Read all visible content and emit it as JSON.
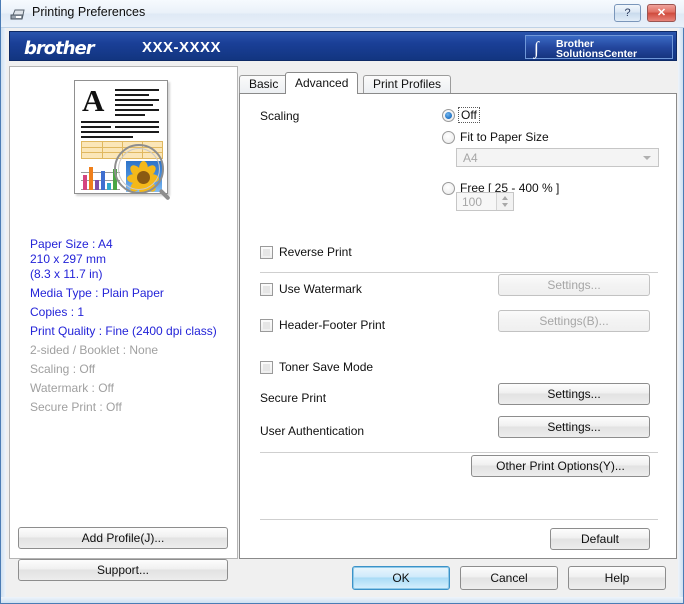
{
  "window": {
    "title": "Printing Preferences",
    "title_icon": "printer-icon",
    "help_button": "?",
    "close_button": "✕"
  },
  "banner": {
    "logo": "brother",
    "model": "XXX-XXXX",
    "solutions_center": {
      "swoosh": "∫",
      "line1": "Brother",
      "line2": "SolutionsCenter"
    }
  },
  "preview": {
    "alt": "document-preview-thumbnail",
    "letter": "A"
  },
  "summary": [
    {
      "text": "Paper Size : A4",
      "state": "active"
    },
    {
      "text": "210 x 297 mm",
      "state": "active"
    },
    {
      "text": "(8.3 x 11.7 in)",
      "state": "active"
    },
    {
      "text": "Media Type : Plain Paper",
      "state": "active"
    },
    {
      "text": "Copies : 1",
      "state": "active"
    },
    {
      "text": "Print Quality : Fine (2400 dpi class)",
      "state": "active"
    },
    {
      "text": "2-sided / Booklet : None",
      "state": "dim"
    },
    {
      "text": "Scaling : Off",
      "state": "dim"
    },
    {
      "text": "Watermark : Off",
      "state": "dim"
    },
    {
      "text": "Secure Print : Off",
      "state": "dim"
    }
  ],
  "left_buttons": {
    "add_profile": "Add Profile(J)...",
    "support": "Support..."
  },
  "tabs": [
    {
      "label": "Basic",
      "active": false
    },
    {
      "label": "Advanced",
      "active": true
    },
    {
      "label": "Print Profiles",
      "active": false
    }
  ],
  "advanced": {
    "scaling": {
      "label": "Scaling",
      "options": [
        {
          "label": "Off",
          "checked": true,
          "focused": true
        },
        {
          "label": "Fit to Paper Size",
          "checked": false,
          "focused": false
        },
        {
          "label": "Free [ 25 - 400 % ]",
          "checked": false,
          "focused": false
        }
      ],
      "paper_size_value": "A4",
      "free_value": "100"
    },
    "reverse_print": {
      "label": "Reverse Print",
      "checked": false
    },
    "use_watermark": {
      "label": "Use Watermark",
      "checked": false,
      "button": "Settings...",
      "button_enabled": false
    },
    "header_footer_print": {
      "label": "Header-Footer Print",
      "checked": false,
      "button": "Settings(B)...",
      "button_enabled": false
    },
    "toner_save_mode": {
      "label": "Toner Save Mode",
      "checked": false
    },
    "secure_print": {
      "label": "Secure Print",
      "button": "Settings...",
      "button_enabled": true
    },
    "user_authentication": {
      "label": "User Authentication",
      "button": "Settings...",
      "button_enabled": true
    },
    "other_print_options": "Other Print Options(Y)...",
    "default_button": "Default"
  },
  "dialog_buttons": {
    "ok": "OK",
    "cancel": "Cancel",
    "help": "Help"
  },
  "colors": {
    "banner_blue": "#1a3f97",
    "summary_active": "#2323d8",
    "summary_dim": "#a0a0a0",
    "default_button_accent": "#3c92c8",
    "close_button_red": "#cf4a3c"
  }
}
